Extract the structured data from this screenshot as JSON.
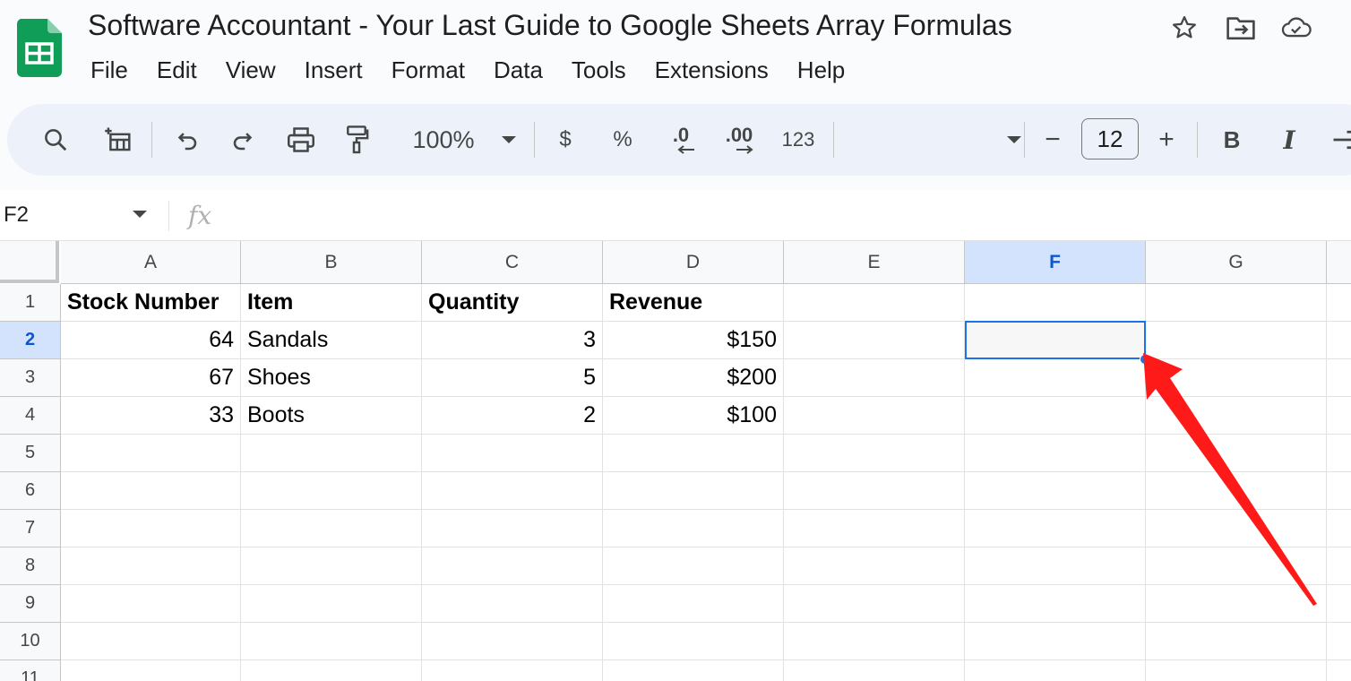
{
  "title": "Software Accountant - Your Last Guide to Google Sheets Array Formulas",
  "menu": [
    "File",
    "Edit",
    "View",
    "Insert",
    "Format",
    "Data",
    "Tools",
    "Extensions",
    "Help"
  ],
  "toolbar": {
    "zoom": "100%",
    "currency": "$",
    "percent": "%",
    "decrease_decimal": ".0",
    "increase_decimal": ".00",
    "number_format": "123",
    "font_size": "12",
    "minus": "−",
    "plus": "+",
    "bold": "B",
    "italic": "I"
  },
  "formula_bar": {
    "name_box": "F2",
    "fx": "fx"
  },
  "columns": [
    "A",
    "B",
    "C",
    "D",
    "E",
    "F",
    "G"
  ],
  "selected_column": "F",
  "rows": [
    "1",
    "2",
    "3",
    "4",
    "5",
    "6",
    "7",
    "8",
    "9",
    "10",
    "11"
  ],
  "selected_row": "2",
  "cells": {
    "A1": "Stock Number",
    "B1": "Item",
    "C1": "Quantity",
    "D1": "Revenue",
    "A2": "64",
    "B2": "Sandals",
    "C2": "3",
    "D2": "$150",
    "A3": "67",
    "B3": "Shoes",
    "C3": "5",
    "D3": "$200",
    "A4": "33",
    "B4": "Boots",
    "C4": "2",
    "D4": "$100"
  },
  "selected_cell": "F2",
  "colors": {
    "accent": "#1a73e8",
    "annotation_arrow": "#ff1a1a",
    "sheets_green": "#0f9d58"
  }
}
